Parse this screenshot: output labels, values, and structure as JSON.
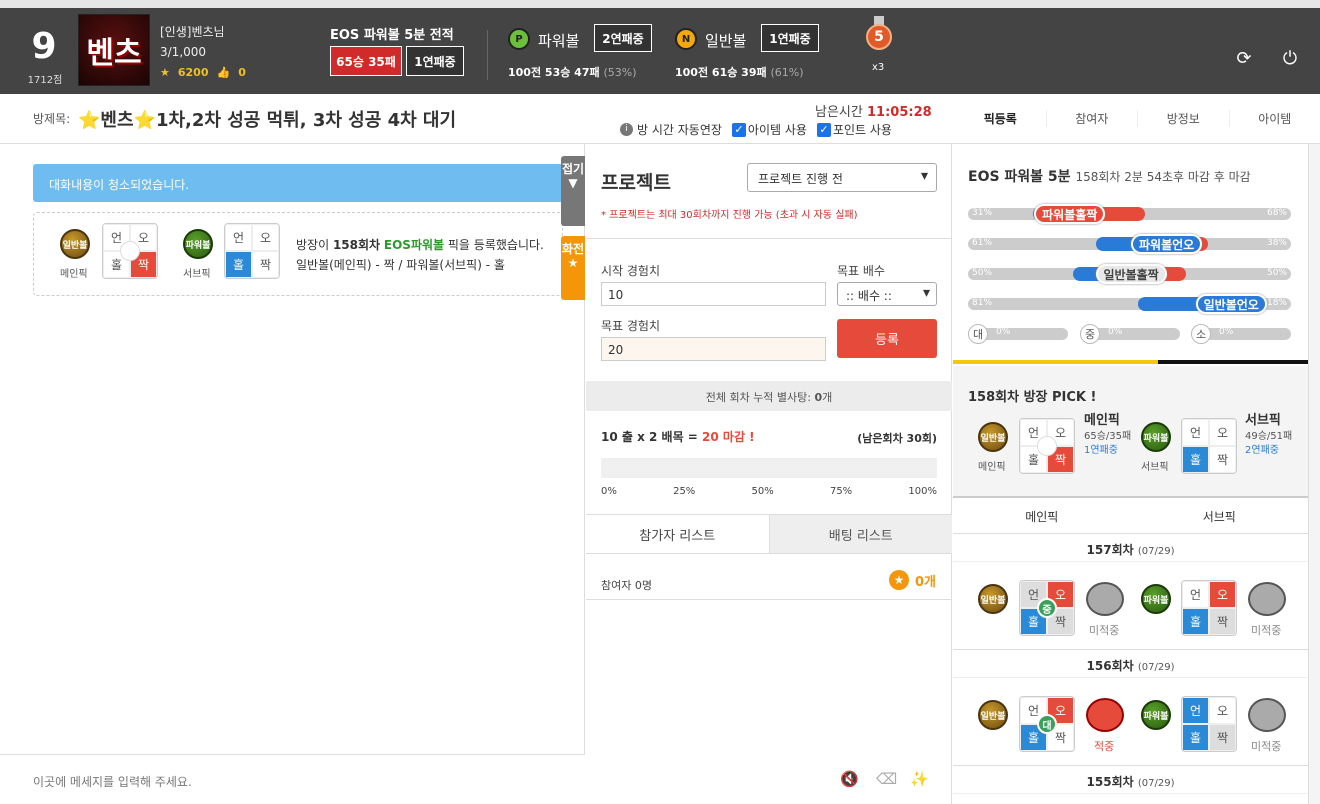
{
  "header": {
    "level": "9",
    "points": "1712점",
    "logo_text": "벤츠",
    "username": "[인생]벤츠님",
    "member_count": "3/1,000",
    "star_count": "6200",
    "like_count": "0",
    "record_title": "EOS 파워볼 5분 전적",
    "record_winloss": "65승 35패",
    "record_streak": "1연패중",
    "powerball_label": "파워볼",
    "powerball_ball": "P",
    "powerball_streak": "2연패중",
    "powerball_stat": "100전 53승 47패",
    "powerball_pct": "(53%)",
    "normal_label": "일반볼",
    "normal_ball": "N",
    "normal_streak": "1연패중",
    "normal_stat": "100전 61승 39패",
    "normal_pct": "(61%)",
    "medal_num": "5",
    "medal_mult": "x3"
  },
  "room": {
    "label": "방제목:",
    "title": "⭐벤츠⭐1차,2차 성공 먹튀, 3차 성공 4차 대기",
    "time_label": "남은시간",
    "time_value": "11:05:28",
    "auto_extend": "방 시간 자동연장",
    "item_use": "아이템 사용",
    "point_use": "포인트 사용",
    "tabs": [
      "픽등록",
      "참여자",
      "방정보",
      "아이템"
    ]
  },
  "chat": {
    "notice": "대화내용이 청소되었습니다.",
    "fold_label": "접기",
    "swap_label": "화전",
    "main_ball": "일반볼",
    "main_label": "메인픽",
    "sub_ball": "파워볼",
    "sub_label": "서브픽",
    "g_odd": "오",
    "g_under": "언",
    "g_odd2": "홀",
    "g_even": "짝",
    "msg_prefix": "방장이 ",
    "msg_round": "158회차",
    "msg_game": "EOS파워볼",
    "msg_suffix": " 픽을 등록했습니다.",
    "msg_line2": "일반볼(메인픽) - 짝 / 파워볼(서브픽) - 홀",
    "input_placeholder": "이곳에 메세지를 입력해 주세요."
  },
  "project": {
    "title": "프로젝트",
    "status_select": "프로젝트 진행 전",
    "warning": "* 프로젝트는 최대 30회차까지 진행 가능 (초과 시 자동 실패)",
    "start_label": "시작 경험치",
    "start_value": "10",
    "target_mult_label": "목표 배수",
    "target_mult_value": ":: 배수 ::",
    "target_label": "목표 경험치",
    "target_value": "20",
    "register_btn": "등록",
    "total_bar_prefix": "전체 회차 누적 별사탕: ",
    "total_bar_count": "0",
    "total_bar_unit": "개",
    "calc_a": "10 출 x 2 배목 = ",
    "calc_b": "20 마감 !",
    "remain": "(남은회차 30회)",
    "progress_pct": 0,
    "ticks": [
      "0%",
      "25%",
      "50%",
      "75%",
      "100%"
    ],
    "tab_participants": "참가자 리스트",
    "tab_bets": "배팅 리스트",
    "participants": "참여자 0명",
    "stars": "0개"
  },
  "stats": {
    "title": "EOS 파워볼 5분",
    "round_info": "158회차 2분 54초후 마감 후 마감",
    "rows": [
      {
        "left": "31%",
        "right": "68%",
        "label": "파워볼홀짝",
        "blue": 31,
        "red": 68,
        "pill": "#e54a3a"
      },
      {
        "left": "61%",
        "right": "38%",
        "label": "파워볼언오",
        "blue": 61,
        "red": 38,
        "pill": "#2a7ad8"
      },
      {
        "left": "50%",
        "right": "50%",
        "label": "일반볼홀짝",
        "blue": 50,
        "red": 50,
        "pill": "#e8e8e8"
      },
      {
        "left": "81%",
        "right": "18%",
        "label": "일반볼언오",
        "blue": 81,
        "red": 18,
        "pill": "#2a7ad8"
      }
    ],
    "sizes": [
      {
        "t": "대",
        "v": "0%"
      },
      {
        "t": "중",
        "v": "0%"
      },
      {
        "t": "소",
        "v": "0%"
      }
    ],
    "pick_header": "158회차 방장 PICK !",
    "main_title": "메인픽",
    "main_rec": "65승/35패",
    "main_streak": "1연패중",
    "sub_title": "서브픽",
    "sub_rec": "49승/51패",
    "sub_streak": "2연패중",
    "hist_main": "메인픽",
    "hist_sub": "서브픽",
    "r157": "157회차",
    "r157d": "(07/29)",
    "r156": "156회차",
    "r156d": "(07/29)",
    "r155": "155회차",
    "r155d": "(07/29)",
    "res_miss": "미적중",
    "res_hit": "적중",
    "res_mid": "중",
    "res_big": "대"
  }
}
